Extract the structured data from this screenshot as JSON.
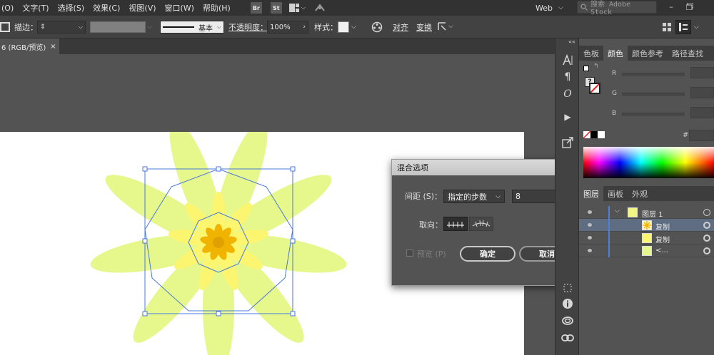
{
  "menubar": {
    "items": [
      "(O)",
      "文字(T)",
      "选择(S)",
      "效果(C)",
      "视图(V)",
      "窗口(W)",
      "帮助(H)"
    ],
    "apps": [
      "Br",
      "St"
    ],
    "workspace": "Web",
    "stock_search_placeholder": "搜索 Adobe Stock"
  },
  "controlbar": {
    "stroke_label": "描边：",
    "brush_label": "基本",
    "opacity_label": "不透明度：",
    "opacity_value": "100%",
    "style_label": "样式：",
    "align_label": "对齐",
    "transform_label": "变换"
  },
  "document": {
    "tab_title": "6 (RGB/预览)",
    "tab_close": "×"
  },
  "dialog": {
    "title": "混合选项",
    "spacing_label": "间距 (S)：",
    "spacing_value": "指定的步数",
    "steps_value": "8",
    "orientation_label": "取向：",
    "preview_label": "预览 (P)",
    "ok_label": "确定",
    "cancel_label": "取消"
  },
  "color_panel": {
    "tabs": [
      "色板",
      "颜色",
      "颜色参考",
      "路径查找"
    ],
    "active_tab": 1,
    "channels": [
      "R",
      "G",
      "B"
    ],
    "hex_label": "#"
  },
  "layers_panel": {
    "tabs": [
      "图层",
      "画板",
      "外观"
    ],
    "active_tab": 0,
    "rows": [
      {
        "name": "图层 1",
        "selected": false
      },
      {
        "name": "复制",
        "selected": true
      },
      {
        "name": "复制",
        "selected": false
      },
      {
        "name": "<...",
        "selected": false
      }
    ]
  },
  "colors": {
    "petal_outer": "#e6f78c",
    "petal_mid": "#fbf570",
    "center": "#f0b400",
    "selection": "#4a78e0"
  }
}
